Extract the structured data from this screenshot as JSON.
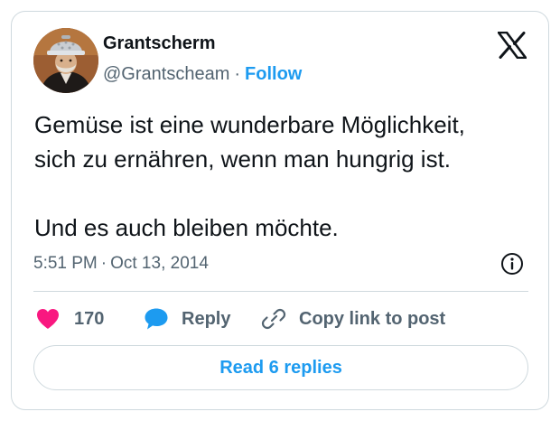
{
  "author": {
    "display_name": "Grantscherm",
    "handle": "@Grantscheam",
    "separator": "·",
    "follow_label": "Follow"
  },
  "tweet": {
    "paragraphs": [
      "Gemüse ist eine wunderbare Möglichkeit,",
      "sich zu ernähren, wenn man hungrig ist.",
      "Und es auch bleiben möchte."
    ],
    "time": "5:51 PM",
    "separator": "·",
    "date": "Oct 13, 2014"
  },
  "actions": {
    "like_count": "170",
    "reply_label": "Reply",
    "copy_link_label": "Copy link to post"
  },
  "read_replies_label": "Read 6 replies",
  "icons": {
    "logo": "x-logo-icon",
    "info": "info-icon",
    "like": "heart-icon",
    "reply": "speech-bubble-icon",
    "copy": "link-icon"
  },
  "colors": {
    "accent": "#1d9bf0",
    "like": "#f91880",
    "text": "#0f1419",
    "secondary_text": "#536471",
    "border": "#cfd9de"
  }
}
